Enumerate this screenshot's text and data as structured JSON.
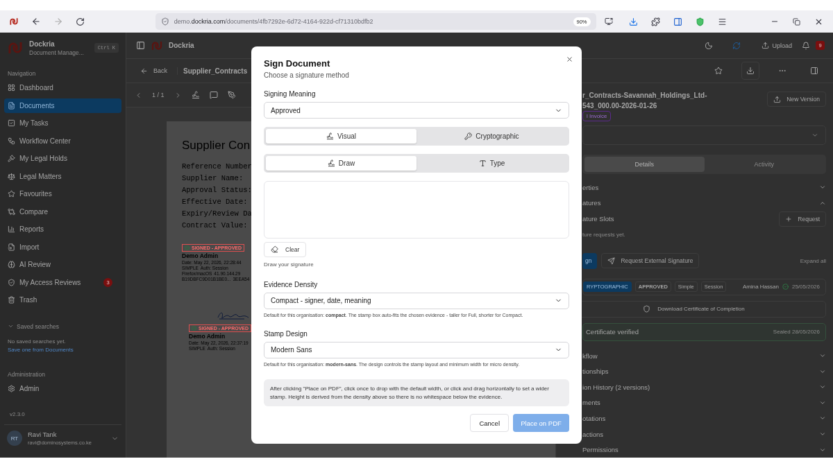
{
  "browser": {
    "url_prefix": "demo.",
    "url_domain": "dockria.com",
    "url_path": "/documents/4fb7292e-6d72-4164-922d-cf71310bdfb2",
    "zoom": "90%"
  },
  "sidebar": {
    "brand": "Dockria",
    "subtitle": "Document Manage...",
    "shortcut": "Ctrl K",
    "nav_title": "Navigation",
    "items": [
      {
        "label": "Dashboard",
        "selected": false
      },
      {
        "label": "Documents",
        "selected": true
      },
      {
        "label": "My Tasks",
        "selected": false
      },
      {
        "label": "Workflow Center",
        "selected": false
      },
      {
        "label": "My Legal Holds",
        "selected": false
      },
      {
        "label": "Legal Matters",
        "selected": false
      },
      {
        "label": "Favourites",
        "selected": false
      },
      {
        "label": "Compare",
        "selected": false
      },
      {
        "label": "Reports",
        "selected": false
      },
      {
        "label": "Import",
        "selected": false
      },
      {
        "label": "AI Review",
        "selected": false
      },
      {
        "label": "My Access Reviews",
        "selected": false,
        "badge": "3"
      },
      {
        "label": "Trash",
        "selected": false
      }
    ],
    "saved_searches": {
      "title": "Saved searches",
      "text": "No saved searches yet.",
      "link": "Save one from Documents"
    },
    "admin_title": "Administration",
    "admin_items": [
      {
        "label": "Admin",
        "selected": false
      }
    ],
    "version": "v2.3.0",
    "user": {
      "initials": "RT",
      "name": "Ravi Tank",
      "email": "ravi@dominosystems.co.ke"
    }
  },
  "header": {
    "app_name": "Dockria",
    "upload": "Upload",
    "notifications": "9"
  },
  "titlebar": {
    "back": "Back",
    "title": "Supplier_Contracts"
  },
  "viewer": {
    "page": "1 / 1"
  },
  "document": {
    "heading": "Supplier Con",
    "fields": [
      "Reference Number",
      "Supplier Name:",
      "Approval Status:",
      "Effective Date:",
      "Expiry/Review Da",
      "Contract Value:"
    ],
    "stamps": [
      {
        "signature": false,
        "status": "SIGNED - APPROVED",
        "signer": "Demo Admin",
        "date": "Date: May 22, 2026, 22:28:44",
        "lines": [
          [
            "SIMPLE",
            "Auth: Session"
          ],
          [
            "Firefox/macOS",
            "41.90.144.29"
          ],
          [
            "B19DBFC9D01B1BE0...",
            "3EEA54"
          ]
        ]
      },
      {
        "signature": true,
        "status": "SIGNED - APPROVED",
        "signer": "Demo Admin",
        "date": "Date: May 22, 2026, 22:37:19",
        "lines": [
          [
            "SIMPLE",
            "Auth: Session"
          ]
        ]
      }
    ]
  },
  "details": {
    "title_lines": [
      "r_Contracts-Savannah_Holdings_Ltd-",
      "543_000.00-2026-01-26"
    ],
    "new_version": "New Version",
    "tag": "l Invoice",
    "tabs": [
      {
        "label": "Details",
        "selected": true
      },
      {
        "label": "Activity",
        "selected": false
      }
    ],
    "sections": [
      {
        "label": "erties",
        "expanded": false
      },
      {
        "label": "atures",
        "expanded": true
      }
    ],
    "slots": {
      "label": "ature Slots",
      "request": "Request",
      "empty": "ture requests yet."
    },
    "sign": "gn",
    "request_external": "Request External Signature",
    "expand_all": "Expand all",
    "signature": {
      "chips": [
        {
          "label": "RYPTOGRAPHIC",
          "kind": "method"
        },
        {
          "label": "APPROVED",
          "kind": "meaning"
        },
        {
          "label": "Simple",
          "kind": "level"
        },
        {
          "label": "Session",
          "kind": "auth"
        }
      ],
      "signer": "Amina Hassan",
      "date": "25/05/2026"
    },
    "certificate_download": "Download Certificate of Completion",
    "certificate": {
      "status": "Certificate verified",
      "sealed": "Sealed 28/05/2026"
    },
    "more_sections": [
      {
        "label": "kflow",
        "expanded": false
      },
      {
        "label": "tionships",
        "expanded": false
      },
      {
        "label": "ion History (2 versions)",
        "expanded": false
      },
      {
        "label": "ments",
        "expanded": false
      },
      {
        "label": "otations",
        "expanded": false
      },
      {
        "label": "actions",
        "expanded": false
      },
      {
        "label": "Permissions",
        "expanded": false
      }
    ]
  },
  "dialog": {
    "title": "Sign Document",
    "subtitle": "Choose a signature method",
    "meaning": {
      "label": "Signing Meaning",
      "value": "Approved"
    },
    "method_tabs": [
      {
        "label": "Visual",
        "selected": true
      },
      {
        "label": "Cryptographic",
        "selected": false
      }
    ],
    "input_tabs": [
      {
        "label": "Draw",
        "selected": true
      },
      {
        "label": "Type",
        "selected": false
      }
    ],
    "clear": "Clear",
    "hint": "Draw your signature",
    "density": {
      "label": "Evidence Density",
      "value": "Compact - signer, date, meaning",
      "help": "Default for this organisation: **compact**. The stamp box auto-fits the chosen evidence - taller for Full, shorter for Compact."
    },
    "design": {
      "label": "Stamp Design",
      "value": "Modern Sans",
      "help": "Default for this organisation: **modern-sans**. The design controls the stamp layout and minimum width for micro density."
    },
    "note": "After clicking \"Place on PDF\", click once to drop with the default width, or click and drag horizontally to set a wider stamp. Height is derived from the density above so there is no whitespace below the evidence.",
    "cancel": "Cancel",
    "place": {
      "label": "Place on PDF",
      "disabled": true
    }
  }
}
